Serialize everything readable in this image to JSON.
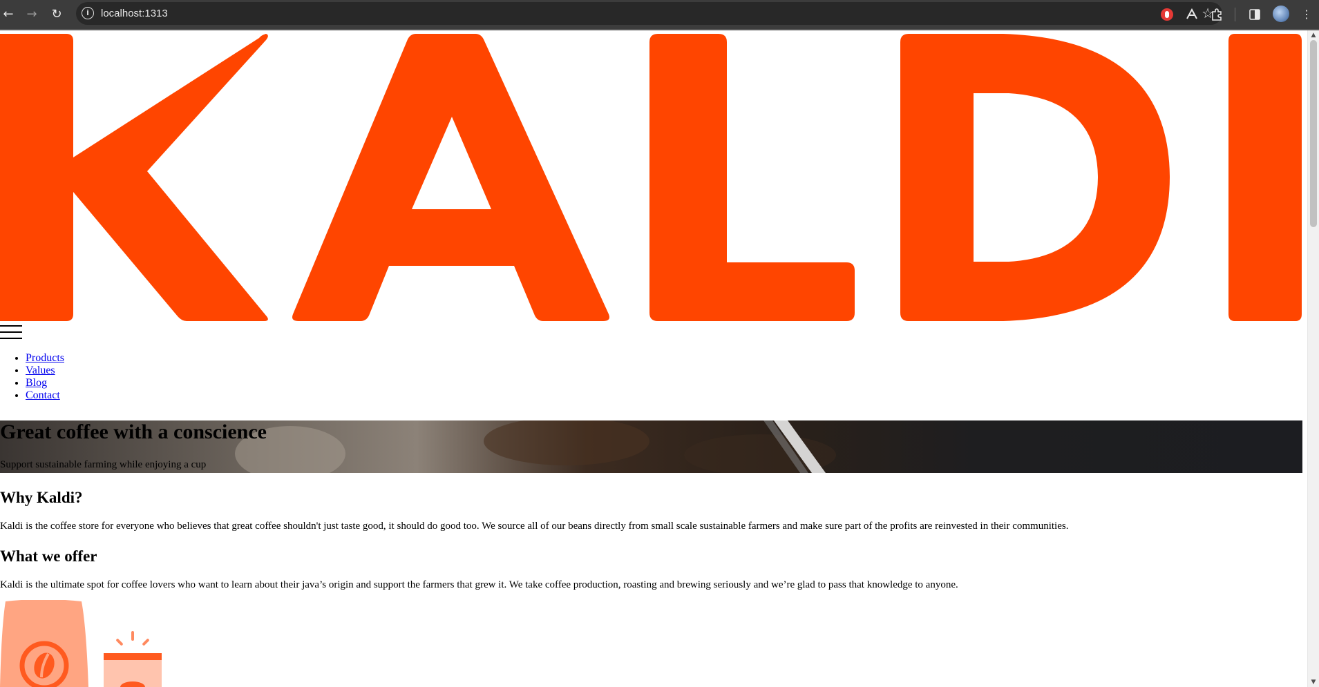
{
  "browser": {
    "url": "localhost:1313",
    "icons": {
      "back": "arrow-left-icon",
      "forward": "arrow-right-icon",
      "reload": "reload-icon",
      "site_info": "info-icon",
      "bookmark": "star-icon",
      "extension_red": "red-extension-icon",
      "extension_a": "a-extension-icon",
      "extensions": "puzzle-icon",
      "side_panel": "side-panel-icon",
      "profile": "profile-avatar",
      "menu": "kebab-menu-icon"
    }
  },
  "logo": {
    "text": "KALDI",
    "color": "#ff4500"
  },
  "nav": {
    "items": [
      {
        "label": "Products"
      },
      {
        "label": "Values"
      },
      {
        "label": "Blog"
      },
      {
        "label": "Contact"
      }
    ]
  },
  "hero": {
    "title": "Great coffee with a conscience",
    "subtitle": "Support sustainable farming while enjoying a cup"
  },
  "why": {
    "heading": "Why Kaldi?",
    "text": "Kaldi is the coffee store for everyone who believes that great coffee shouldn't just taste good, it should do good too. We source all of our beans directly from small scale sustainable farmers and make sure part of the profits are reinvested in their communities."
  },
  "offer": {
    "heading": "What we offer",
    "text": "Kaldi is the ultimate spot for coffee lovers who want to learn about their java’s origin and support the farmers that grew it. We take coffee production, roasting and brewing seriously and we’re glad to pass that knowledge to anyone."
  },
  "colors": {
    "accent": "#ff4500",
    "illustration": "#ffa582",
    "illustration_dark": "#ff5a1f",
    "link": "#0000ee"
  }
}
